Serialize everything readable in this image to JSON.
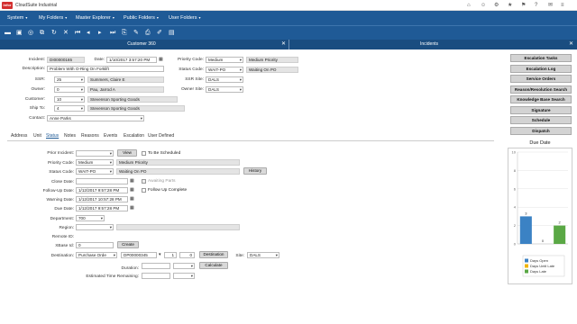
{
  "app": {
    "logo": "infor",
    "title": "CloudSuite Industrial"
  },
  "menu": [
    {
      "label": "System"
    },
    {
      "label": "My Folders"
    },
    {
      "label": "Master Explorer"
    },
    {
      "label": "Public Folders"
    },
    {
      "label": "User Folders"
    }
  ],
  "tabs": {
    "left": "Customer 360",
    "right": "Incidents"
  },
  "form": {
    "incident": {
      "label": "Incident:",
      "value": "DI00000165"
    },
    "date": {
      "label": "Date:",
      "value": "1/10/2017 3:57:20 PM"
    },
    "priority_code": {
      "label": "Priority Code:",
      "value": "Medium",
      "desc": "Medium Priority"
    },
    "description": {
      "label": "Description:",
      "value": "Problem With O-Ring On Forklift"
    },
    "status_code": {
      "label": "Status Code:",
      "value": "WAIT-PO",
      "desc": "Waiting On PO"
    },
    "ssr": {
      "label": "SSR:",
      "value": "25",
      "desc": "Summers, Claire E"
    },
    "ssr_site": {
      "label": "SSR Site:",
      "value": "DALS"
    },
    "owner": {
      "label": "Owner:",
      "value": "0",
      "desc": "Pau, Jarrod A"
    },
    "owner_site": {
      "label": "Owner Site:",
      "value": "DALS"
    },
    "customer": {
      "label": "Customer:",
      "value": "10",
      "desc": "Stevenson Sporting Goods"
    },
    "ship_to": {
      "label": "Ship To:",
      "value": "4",
      "desc": "Stevenson Sporting Goods"
    },
    "contact": {
      "label": "Contact:",
      "value": "Anne Parks"
    }
  },
  "subtabs": [
    "Address",
    "Unit",
    "Status",
    "Notes",
    "Reasons",
    "Events",
    "Escalation",
    "User Defined"
  ],
  "status": {
    "prior_incident": {
      "label": "Prior Incident:",
      "value": ""
    },
    "view_button": "View",
    "to_be_scheduled": "To Be Scheduled",
    "priority_code": {
      "label": "Priority Code:",
      "value": "Medium",
      "desc": "Medium Priority"
    },
    "status_code": {
      "label": "Status Code:",
      "value": "WAIT-PO",
      "desc": "Waiting On PO"
    },
    "history_button": "History",
    "close_date": {
      "label": "Close Date:",
      "value": ""
    },
    "awaiting_parts": "Awaiting Parts",
    "follow_up_date": {
      "label": "Follow-Up Date:",
      "value": "1/12/2017 9:57:28 PM"
    },
    "follow_up_complete": "Follow Up Complete",
    "warning_date": {
      "label": "Warning Date:",
      "value": "1/12/2017 10:57:28 PM"
    },
    "due_date": {
      "label": "Due Date:",
      "value": "1/12/2017 9:57:28 PM"
    },
    "department": {
      "label": "Department:",
      "value": "700"
    },
    "region": {
      "label": "Region:",
      "value": ""
    },
    "remote_id": {
      "label": "Remote ID:",
      "value": ""
    },
    "xbase_id": {
      "label": "XBase Id:",
      "value": "0"
    },
    "create_button": "Create",
    "destination": {
      "label": "Destination:",
      "type": "Purchase Orde",
      "number": "DP00000345",
      "line": "1",
      "release": "0"
    },
    "destination_button": "Destination",
    "site": {
      "label": "Site:",
      "value": "DALS"
    },
    "duration": {
      "label": "Duration:",
      "value": ""
    },
    "calculate_button": "Calculate",
    "estimated_time": {
      "label": "Estimated Time Remaining:",
      "value": ""
    }
  },
  "actions": [
    "Escalation Tasks",
    "Escalation Log",
    "Service Orders",
    "Reason/Resolution Search",
    "Knowledge Base Search",
    "Signature",
    "Schedule",
    "Dispatch"
  ],
  "chart_data": {
    "type": "bar",
    "title": "Due Date",
    "categories": [
      "Days Open",
      "Days Until Late",
      "Days Late"
    ],
    "values": [
      3,
      0,
      2
    ],
    "colors": [
      "#3b82c4",
      "#f0b400",
      "#5aa845"
    ],
    "ylim": [
      0,
      10
    ],
    "yticks": [
      "0",
      "2",
      "4",
      "6",
      "8",
      "10"
    ],
    "data_labels": [
      "3",
      "0",
      "2"
    ],
    "legend": [
      "Days Open",
      "Days Until Late",
      "Days Late"
    ],
    "legend_position": "bottom",
    "grid": true
  }
}
